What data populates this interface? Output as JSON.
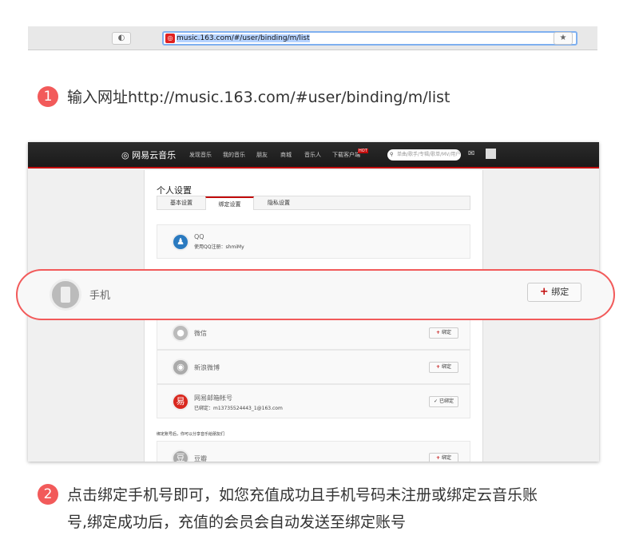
{
  "browser": {
    "url": "music.163.com/#/user/binding/m/list"
  },
  "steps": [
    {
      "num": "1",
      "text": "输入网址http://music.163.com/#user/binding/m/list"
    },
    {
      "num": "2",
      "text_line1": "点击绑定手机号即可，如您充值成功且手机号码未注册或绑定云音乐账",
      "text_line2": "号,绑定成功后，充值的会员会自动发送至绑定账号"
    }
  ],
  "site": {
    "logo": "网易云音乐",
    "nav": [
      "发现音乐",
      "我的音乐",
      "朋友",
      "商城",
      "音乐人",
      "下载客户端"
    ],
    "hot": "HOT",
    "search_placeholder": "单曲/歌手/专辑/歌单/MV/用户",
    "page_title": "个人设置",
    "tabs": [
      "基本设置",
      "绑定设置",
      "隐私设置"
    ],
    "qq": {
      "name": "QQ",
      "sub": "使用QQ注册：shmiMy"
    },
    "phone": {
      "name": "手机",
      "button": "绑定"
    },
    "wechat": {
      "name": "微信",
      "button": "绑定"
    },
    "weibo": {
      "name": "新浪微博",
      "button": "绑定"
    },
    "netease": {
      "name": "网易邮箱帐号",
      "sub": "已绑定：m13735524443_1@163.com",
      "button": "已绑定"
    },
    "note": "绑定账号后，你可以分享音乐给朋友们",
    "douban": {
      "name": "豆瓣",
      "button": "绑定"
    }
  },
  "colors": {
    "accent": "#f25a5a",
    "brand": "#c20c0c"
  }
}
